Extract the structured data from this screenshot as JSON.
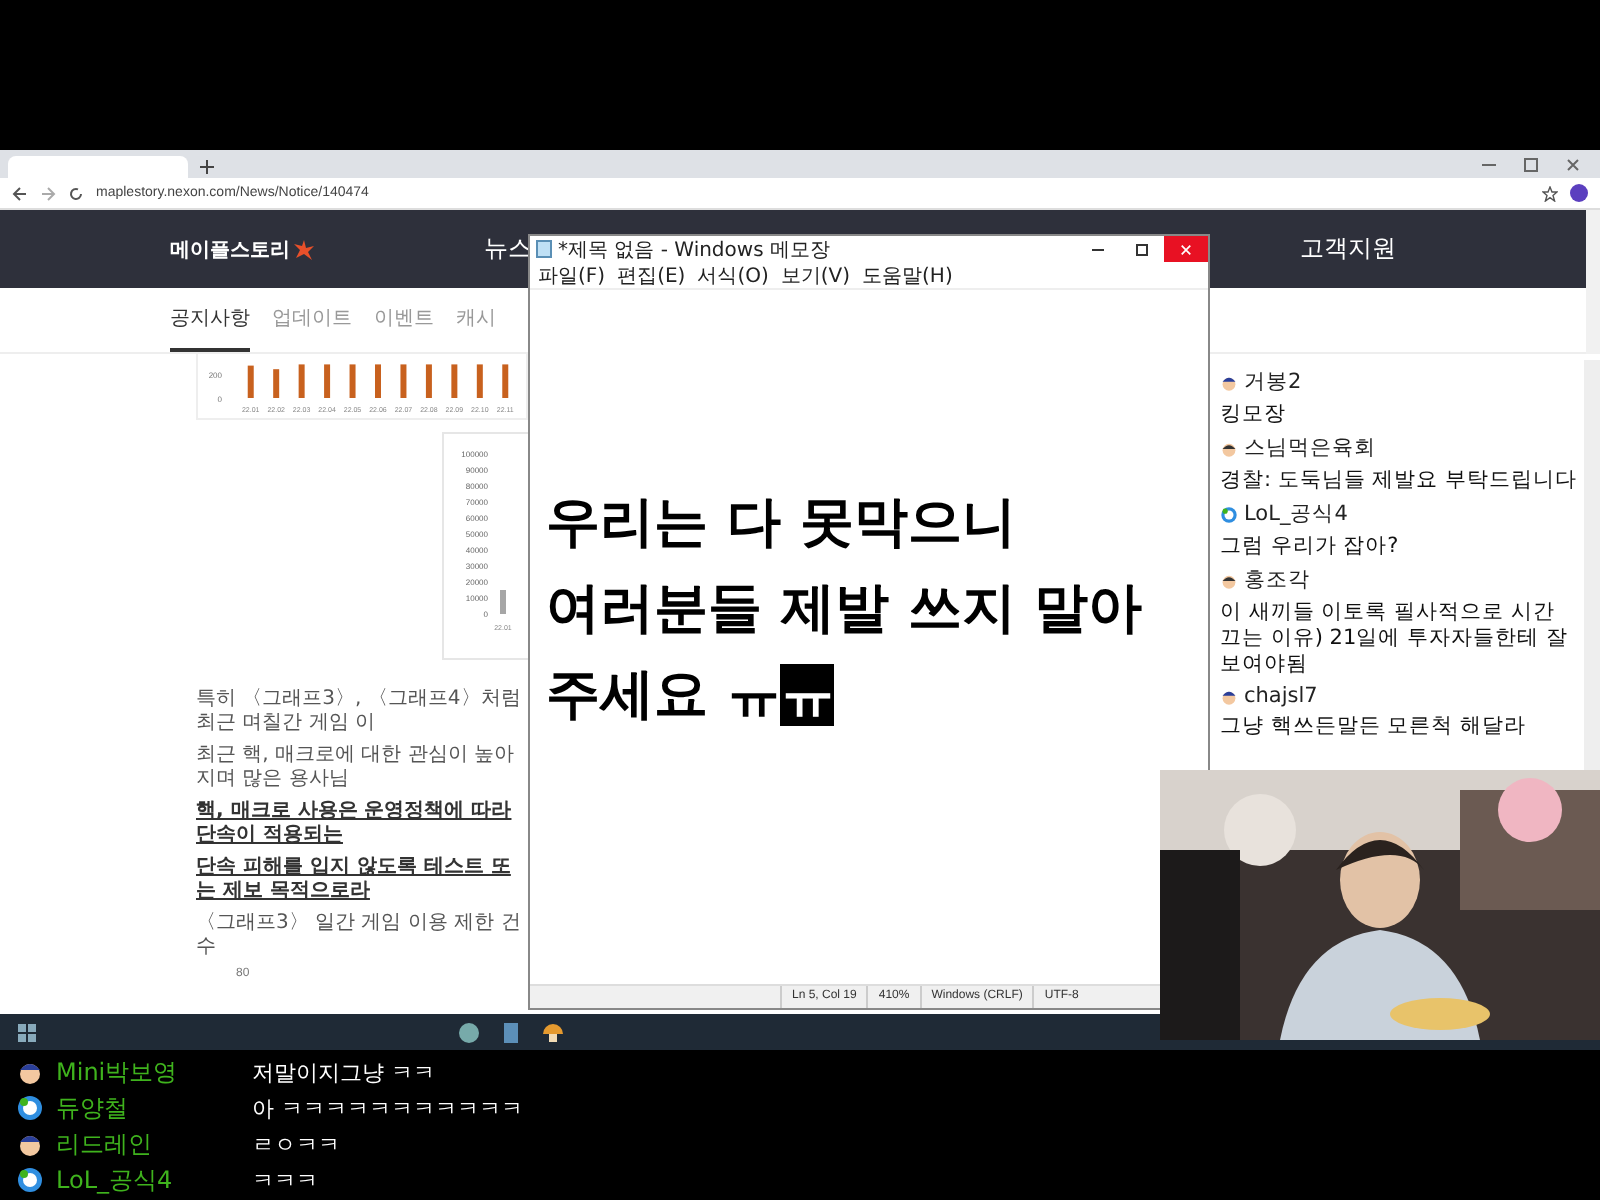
{
  "browser": {
    "address": "maplestory.nexon.com/News/Notice/140474",
    "site_header": {
      "logo": "메이플스토리",
      "nav": [
        "뉴스",
        "고객지원"
      ]
    },
    "tabs": [
      {
        "label": "공지사항",
        "selected": true
      },
      {
        "label": "업데이트",
        "selected": false
      },
      {
        "label": "이벤트",
        "selected": false
      },
      {
        "label": "캐시",
        "selected": false
      }
    ],
    "chart_1": {
      "chart_data": {
        "type": "bar",
        "categories": [
          "22.01",
          "22.02",
          "22.03",
          "22.04",
          "22.05",
          "22.06",
          "22.07",
          "22.08",
          "22.09",
          "22.10",
          "22.11"
        ],
        "values": [
          270,
          240,
          280,
          280,
          280,
          280,
          280,
          280,
          280,
          280,
          280
        ],
        "yticks": [
          0,
          200
        ],
        "ylim": [
          0,
          300
        ]
      }
    },
    "chart_2": {
      "chart_data": {
        "type": "bar",
        "categories": [
          "22.01"
        ],
        "values": [
          15000
        ],
        "yticks": [
          0,
          10000,
          20000,
          30000,
          40000,
          50000,
          60000,
          70000,
          80000,
          90000,
          100000
        ],
        "ylim": [
          0,
          100000
        ]
      }
    },
    "paragraphs": [
      {
        "kind": "plain",
        "text": "특히 〈그래프3〉, 〈그래프4〉처럼 최근 며칠간 게임 이"
      },
      {
        "kind": "plain",
        "text": "최근 핵, 매크로에 대한 관심이 높아지며 많은 용사님"
      },
      {
        "kind": "emphasis",
        "text": "핵, 매크로 사용은 운영정책에 따라 단속이 적용되는"
      },
      {
        "kind": "emphasis",
        "text": "단속 피해를 입지 않도록 테스트 또는 제보 목적으로라"
      },
      {
        "kind": "plain",
        "text": "〈그래프3〉 일간 게임 이용 제한 건수"
      }
    ],
    "next_chart_tick": "80"
  },
  "notepad": {
    "title": "*제목 없음 - Windows 메모장",
    "menu": [
      "파일(F)",
      "편집(E)",
      "서식(O)",
      "보기(V)",
      "도움말(H)"
    ],
    "lines": [
      [
        {
          "text": "우리는 다 못막으니",
          "selected": false
        }
      ],
      [
        {
          "text": "여러분들 제발 쓰지 말아",
          "selected": false
        }
      ],
      [
        {
          "text": "주세요 ㅠ",
          "selected": false
        },
        {
          "text": "ㅠ",
          "selected": true
        }
      ]
    ],
    "status": [
      "Ln 5, Col 19",
      "410%",
      "Windows (CRLF)",
      "UTF-8"
    ]
  },
  "side_chat": [
    {
      "user": "거봉2",
      "text": "킹모장",
      "kind": "cap"
    },
    {
      "user": "스님먹은육회",
      "text": "경찰: 도둑님들 제발요 부탁드립니다",
      "kind": "plain"
    },
    {
      "user": "LoL_공식4",
      "text": "그럼 우리가 잡아?",
      "kind": "round"
    },
    {
      "user": "홍조각",
      "text": "이 새끼들 이토록 필사적으로 시간 끄는 이유) 21일에 투자자들한테 잘보여야됨",
      "kind": "plain"
    },
    {
      "user": "chajsl7",
      "text": "그냥 핵쓰든말든 모른척 해달라",
      "kind": "cap"
    }
  ],
  "bottom_chat": [
    {
      "user": "Mini박보영",
      "text": "저말이지그냥 ㅋㅋ",
      "kind": "cap"
    },
    {
      "user": "듀양철",
      "text": "아 ㅋㅋㅋㅋㅋㅋㅋㅋㅋㅋㅋ",
      "kind": "round"
    },
    {
      "user": "리드레인",
      "text": "ㄹㅇㅋㅋ",
      "kind": "cap"
    },
    {
      "user": "LoL_공식4",
      "text": "ㅋㅋㅋ",
      "kind": "round"
    }
  ]
}
